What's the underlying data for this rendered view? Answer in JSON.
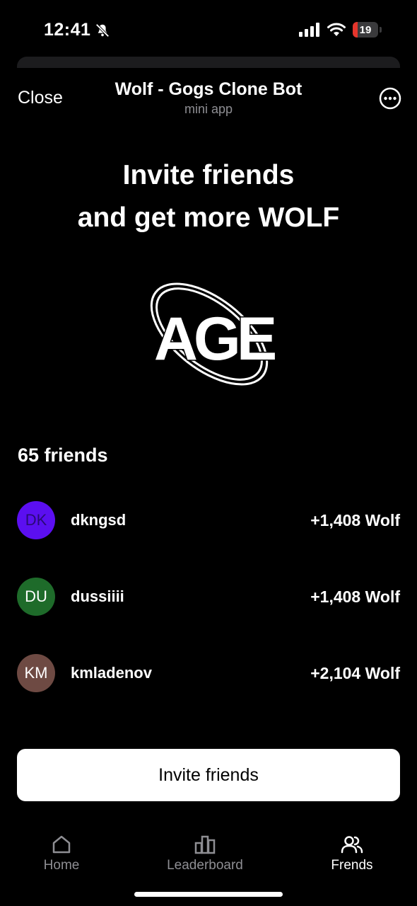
{
  "status_bar": {
    "time": "12:41",
    "battery_level": "19",
    "battery_fraction": 0.19,
    "battery_color": "#e5352c",
    "icons": [
      "bell-slash-icon",
      "cellular-signal-icon",
      "wifi-icon",
      "battery-icon"
    ]
  },
  "header": {
    "close_label": "Close",
    "title": "Wolf - Gogs Clone Bot",
    "subtitle": "mini app",
    "more_icon": "more-options-icon"
  },
  "hero": {
    "line1": "Invite friends",
    "line2": "and get more WOLF",
    "logo_text": "AGE"
  },
  "friends": {
    "count_label": "65 friends",
    "items": [
      {
        "initials": "DK",
        "name": "dkngsd",
        "reward": "+1,408 Wolf",
        "avatar_color": "#5b0ff0",
        "initials_color": "#2a0a77"
      },
      {
        "initials": "DU",
        "name": "dussiiii",
        "reward": "+1,408 Wolf",
        "avatar_color": "#1e6b2a",
        "initials_color": "#ffffff"
      },
      {
        "initials": "KM",
        "name": "kmladenov",
        "reward": "+2,104 Wolf",
        "avatar_color": "#6e4a43",
        "initials_color": "#ffffff"
      }
    ]
  },
  "invite_button": {
    "label": "Invite friends"
  },
  "nav": {
    "items": [
      {
        "label": "Home",
        "icon": "home-icon",
        "active": false
      },
      {
        "label": "Leaderboard",
        "icon": "leaderboard-icon",
        "active": false
      },
      {
        "label": "Frends",
        "icon": "friends-icon",
        "active": true
      }
    ]
  }
}
